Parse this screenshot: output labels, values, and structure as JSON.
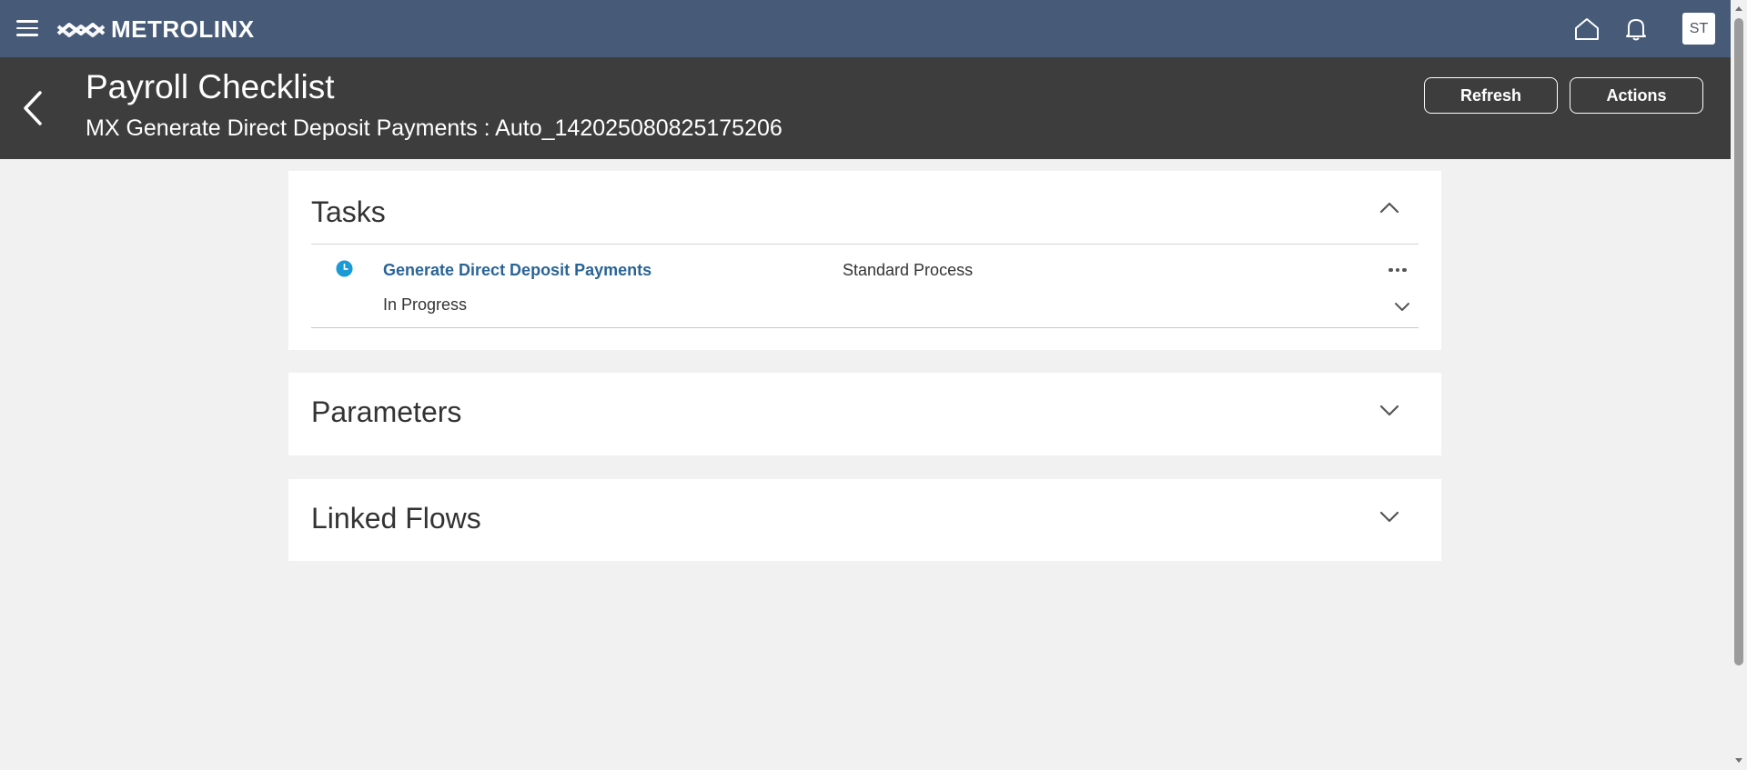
{
  "topbar": {
    "brand": "METROLINX",
    "user_initials": "ST",
    "icons": {
      "menu": "hamburger-icon",
      "home": "home-icon",
      "notifications": "bell-icon"
    }
  },
  "header": {
    "title": "Payroll Checklist",
    "subtitle": "MX Generate Direct Deposit Payments : Auto_142025080825175206",
    "refresh_label": "Refresh",
    "actions_label": "Actions"
  },
  "sections": {
    "tasks": {
      "title": "Tasks",
      "expanded": true,
      "items": [
        {
          "name": "Generate Direct Deposit Payments",
          "type": "Standard Process",
          "status": "In Progress",
          "status_icon": "clock-icon"
        }
      ]
    },
    "parameters": {
      "title": "Parameters",
      "expanded": false
    },
    "linked_flows": {
      "title": "Linked Flows",
      "expanded": false
    }
  },
  "colors": {
    "topbar": "#475b79",
    "header": "#3d3d3d",
    "link": "#2a6496",
    "status_icon": "#1b9ad6",
    "background": "#f1f1f1"
  }
}
